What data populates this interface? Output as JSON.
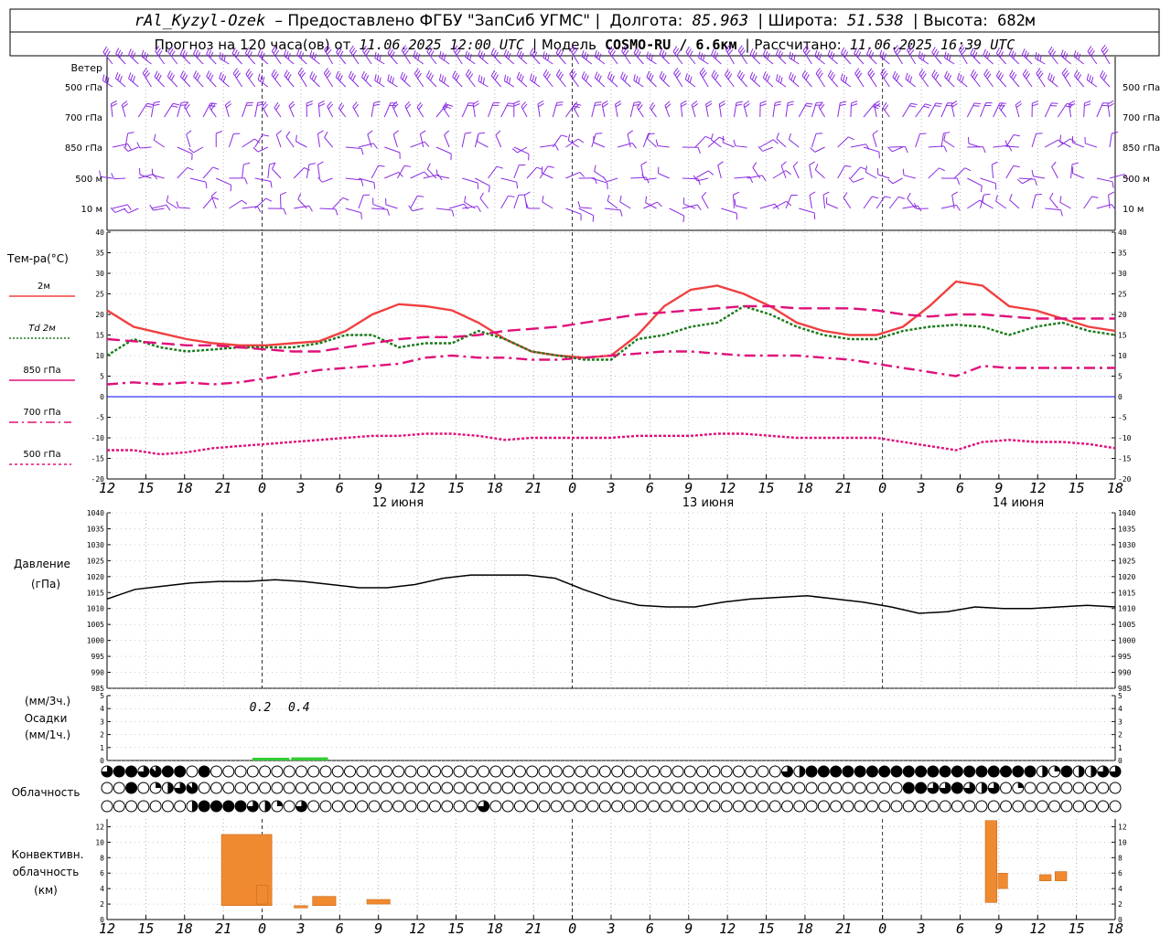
{
  "header": {
    "station": "rAl_Kyzyl-Ozek",
    "provider": "– Предоставлено ФГБУ \"ЗапСиб УГМС\" |",
    "lon_label": "Долгота:",
    "lon_value": "85.963",
    "lat_label": "| Широта:",
    "lat_value": "51.538",
    "alt_label": "| Высота:",
    "alt_value": "682м",
    "forecast_label": "Прогноз на 120 часа(ов) от",
    "forecast_time": "11.06.2025 12:00 UTC",
    "model_label": "| Модель",
    "model_value": "COSMO-RU / 6.6км",
    "calc_label": "| Рассчитано:",
    "calc_time": "11.06.2025 16:39 UTC"
  },
  "chart_data": {
    "type": "meteogram",
    "time_axis": {
      "start_hour_utc": 12,
      "step_hours": 3,
      "tick_labels": [
        "12",
        "15",
        "18",
        "21",
        "0",
        "3",
        "6",
        "9",
        "12",
        "15",
        "18",
        "21",
        "0",
        "3",
        "6",
        "9",
        "12",
        "15",
        "18",
        "21",
        "0",
        "3",
        "6",
        "9",
        "12",
        "15",
        "18"
      ],
      "day_labels": [
        {
          "after_tick": 8,
          "text": "12 июня"
        },
        {
          "after_tick": 16,
          "text": "13 июня"
        },
        {
          "after_tick": 24,
          "text": "14 июня"
        }
      ],
      "midnight_ticks": [
        4,
        12,
        20
      ]
    },
    "wind": {
      "title": "Ветер",
      "levels": [
        "500 гПа",
        "700 гПа",
        "850 гПа",
        "500 м",
        "10 м"
      ],
      "color": "#8a2be2"
    },
    "temperature": {
      "title": "Тем-ра(°C)",
      "ylim": [
        -20,
        40
      ],
      "y_ticks": [
        -20,
        -15,
        -10,
        -5,
        0,
        5,
        10,
        15,
        20,
        25,
        30,
        35,
        40
      ],
      "zero_line_color": "#0000ff",
      "series": [
        {
          "name": "2м",
          "style": "solid",
          "color": "#f04040",
          "values": [
            21,
            17,
            15.5,
            14,
            13,
            12.5,
            12.5,
            13,
            13.5,
            16,
            20,
            22.5,
            22,
            21,
            18,
            14,
            11,
            10,
            9.5,
            10,
            15,
            22,
            26,
            27,
            25,
            22,
            18,
            16,
            15,
            15,
            17,
            22,
            28,
            27,
            22,
            21,
            19,
            17,
            16
          ]
        },
        {
          "name": "Td 2м",
          "style": "dotted",
          "color": "#1a7a1a",
          "values": [
            10,
            14,
            12,
            11,
            11.5,
            12,
            12,
            12,
            13,
            15,
            15,
            12,
            13,
            13,
            16,
            14,
            11,
            10,
            9,
            9,
            14,
            15,
            17,
            18,
            22,
            20,
            17,
            15,
            14,
            14,
            16,
            17,
            17.5,
            17,
            15,
            17,
            18,
            16,
            15
          ]
        },
        {
          "name": "850 гПа",
          "style": "longdash",
          "color": "#e0107a",
          "values": [
            14,
            13.5,
            13,
            12.5,
            12.5,
            12,
            11.5,
            11,
            11,
            12,
            13,
            14,
            14.5,
            14.5,
            15,
            16,
            16.5,
            17,
            18,
            19,
            20,
            20.5,
            21,
            21.5,
            22,
            22,
            21.5,
            21.5,
            21.5,
            21,
            20,
            19.5,
            20,
            20,
            19.5,
            19,
            19,
            19,
            19
          ]
        },
        {
          "name": "700 гПа",
          "style": "dashdot",
          "color": "#e0107a",
          "values": [
            3,
            3.5,
            3,
            3.5,
            3,
            3.5,
            4.5,
            5.5,
            6.5,
            7,
            7.5,
            8,
            9.5,
            10,
            9.5,
            9.5,
            9,
            9,
            9.5,
            10,
            10.5,
            11,
            11,
            10.5,
            10,
            10,
            10,
            9.5,
            9,
            8,
            7,
            6,
            5,
            7.5,
            7,
            7,
            7,
            7,
            7
          ]
        },
        {
          "name": "500 гПа",
          "style": "dotted",
          "color": "#e0107a",
          "values": [
            -13,
            -13,
            -14,
            -13.5,
            -12.5,
            -12,
            -11.5,
            -11,
            -10.5,
            -10,
            -9.5,
            -9.5,
            -9,
            -9,
            -9.5,
            -10.5,
            -10,
            -10,
            -10,
            -10,
            -9.5,
            -9.5,
            -9.5,
            -9,
            -9,
            -9.5,
            -10,
            -10,
            -10,
            -10,
            -11,
            -12,
            -13,
            -11,
            -10.5,
            -11,
            -11,
            -11.5,
            -12.5
          ]
        }
      ]
    },
    "pressure": {
      "title": "Давление",
      "unit": "(гПа)",
      "ylim": [
        985,
        1040
      ],
      "y_ticks": [
        985,
        990,
        995,
        1000,
        1005,
        1010,
        1015,
        1020,
        1025,
        1030,
        1035,
        1040
      ],
      "values": [
        1013,
        1016,
        1017,
        1018,
        1018.5,
        1018.5,
        1019,
        1018.5,
        1017.5,
        1016.5,
        1016.5,
        1017.5,
        1019.5,
        1020.5,
        1020.5,
        1020.5,
        1019.5,
        1016,
        1013,
        1011,
        1010.5,
        1010.5,
        1012,
        1013,
        1013.5,
        1014,
        1013,
        1012,
        1010.5,
        1008.5,
        1009,
        1010.5,
        1010,
        1010,
        1010.5,
        1011,
        1010.5
      ]
    },
    "precip": {
      "title": "Осадки",
      "unit_top": "(мм/3ч.)",
      "unit_bottom": "(мм/1ч.)",
      "ylim": [
        0,
        5
      ],
      "y_ticks": [
        0,
        1,
        2,
        3,
        4,
        5
      ],
      "color": "#33cc33",
      "annotations": [
        {
          "tick": 3.75,
          "text": "0.2"
        },
        {
          "tick": 4.75,
          "text": "0.4"
        }
      ],
      "bars_3h": [
        0,
        0,
        0,
        0.2,
        0.4,
        0,
        0,
        0,
        0,
        0,
        0,
        0,
        0,
        0,
        0,
        0,
        0,
        0,
        0,
        0,
        0,
        0,
        0,
        0,
        0,
        0
      ]
    },
    "cloud": {
      "title": "Облачность",
      "symbols_per_row": 40,
      "rows_fill_eighths": {
        "high": [
          6,
          8,
          8,
          6,
          7,
          8,
          8,
          0,
          8,
          0,
          0,
          0,
          0,
          0,
          0,
          0,
          0,
          0,
          0,
          0,
          0,
          0,
          0,
          0,
          0,
          0,
          0,
          0,
          0,
          0,
          0,
          0,
          0,
          0,
          0,
          0,
          0,
          0,
          0,
          0,
          0,
          0,
          0,
          0,
          0,
          0,
          0,
          0,
          0,
          0,
          0,
          0,
          0,
          0,
          0,
          0,
          6,
          4,
          8,
          8,
          8,
          8,
          8,
          8,
          8,
          8,
          8,
          8,
          8,
          8,
          8,
          8,
          8,
          8,
          8,
          8,
          8,
          4,
          2,
          8,
          4,
          4,
          6,
          6
        ],
        "middle": [
          0,
          0,
          8,
          0,
          2,
          4,
          6,
          7,
          0,
          0,
          0,
          0,
          0,
          0,
          0,
          0,
          0,
          0,
          0,
          0,
          0,
          0,
          0,
          0,
          0,
          0,
          0,
          0,
          0,
          0,
          0,
          0,
          0,
          0,
          0,
          0,
          0,
          0,
          0,
          0,
          0,
          0,
          0,
          0,
          0,
          0,
          0,
          0,
          0,
          0,
          0,
          0,
          0,
          0,
          0,
          0,
          0,
          0,
          0,
          0,
          0,
          0,
          0,
          0,
          0,
          0,
          8,
          8,
          6,
          6,
          8,
          6,
          4,
          6,
          0,
          2,
          0,
          0,
          0,
          0,
          0,
          0,
          0,
          0
        ],
        "low": [
          0,
          0,
          0,
          0,
          0,
          0,
          0,
          4,
          8,
          8,
          8,
          8,
          6,
          4,
          2,
          0,
          6,
          0,
          0,
          0,
          0,
          0,
          0,
          0,
          0,
          0,
          0,
          0,
          0,
          0,
          0,
          6,
          0,
          0,
          0,
          0,
          0,
          0,
          0,
          0,
          0,
          0,
          0,
          0,
          0,
          0,
          0,
          0,
          0,
          0,
          0,
          0,
          0,
          0,
          0,
          0,
          0,
          0,
          0,
          0,
          0,
          0,
          0,
          0,
          0,
          0,
          0,
          0,
          0,
          0,
          0,
          0,
          0,
          0,
          0,
          0,
          0,
          0,
          0,
          0,
          0,
          0,
          0,
          0
        ]
      }
    },
    "convective": {
      "title_lines": [
        "Конвективн.",
        "облачность",
        "(км)"
      ],
      "ylim": [
        0,
        13
      ],
      "y_ticks": [
        0,
        2,
        4,
        6,
        8,
        10,
        12
      ],
      "color": "#f08a30",
      "bars_km": [
        {
          "tick": 3.2,
          "width": 0.15,
          "bottom": 2.2,
          "top": 2.6
        },
        {
          "tick": 3.6,
          "width": 1.3,
          "bottom": 1.8,
          "top": 11.0
        },
        {
          "tick": 4.0,
          "width": 0.3,
          "bottom": 2.0,
          "top": 4.4
        },
        {
          "tick": 5.0,
          "width": 0.35,
          "bottom": 1.5,
          "top": 1.8
        },
        {
          "tick": 5.6,
          "width": 0.6,
          "bottom": 1.8,
          "top": 3.0
        },
        {
          "tick": 7.0,
          "width": 0.6,
          "bottom": 2.0,
          "top": 2.6
        },
        {
          "tick": 22.8,
          "width": 0.3,
          "bottom": 2.2,
          "top": 12.8
        },
        {
          "tick": 23.1,
          "width": 0.25,
          "bottom": 4.0,
          "top": 6.0
        },
        {
          "tick": 24.2,
          "width": 0.3,
          "bottom": 5.0,
          "top": 5.8
        },
        {
          "tick": 24.6,
          "width": 0.3,
          "bottom": 5.0,
          "top": 6.2
        }
      ]
    }
  }
}
